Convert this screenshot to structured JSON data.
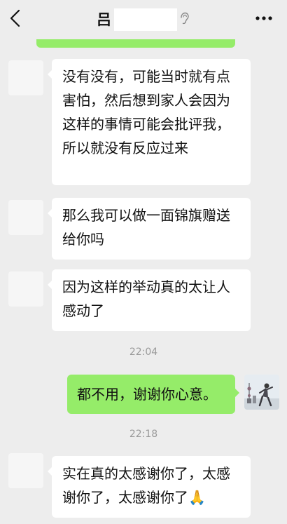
{
  "header": {
    "contact_name": "吕",
    "icons": {
      "back": "chevron-left-icon",
      "mute": "ear-icon",
      "more": "more-dots-icon"
    }
  },
  "messages": [
    {
      "side": "left",
      "text": "没有没有，可能当时就有点害怕，然后想到家人会因为这样的事情可能会批评我，所以就没有反应过来"
    },
    {
      "side": "left",
      "text": "那么我可以做一面锦旗赠送给你吗"
    },
    {
      "side": "left",
      "text": "因为这样的举动真的太让人感动了"
    },
    {
      "time": "22:04"
    },
    {
      "side": "right",
      "text": "都不用，谢谢你心意。"
    },
    {
      "time": "22:18"
    },
    {
      "side": "left",
      "text": "实在真的太感谢你了，太感谢你了，太感谢你了🙏"
    }
  ],
  "colors": {
    "background": "#ededed",
    "incoming_bubble": "#ffffff",
    "outgoing_bubble": "#95ec69",
    "timestamp": "#9a9a9a"
  }
}
